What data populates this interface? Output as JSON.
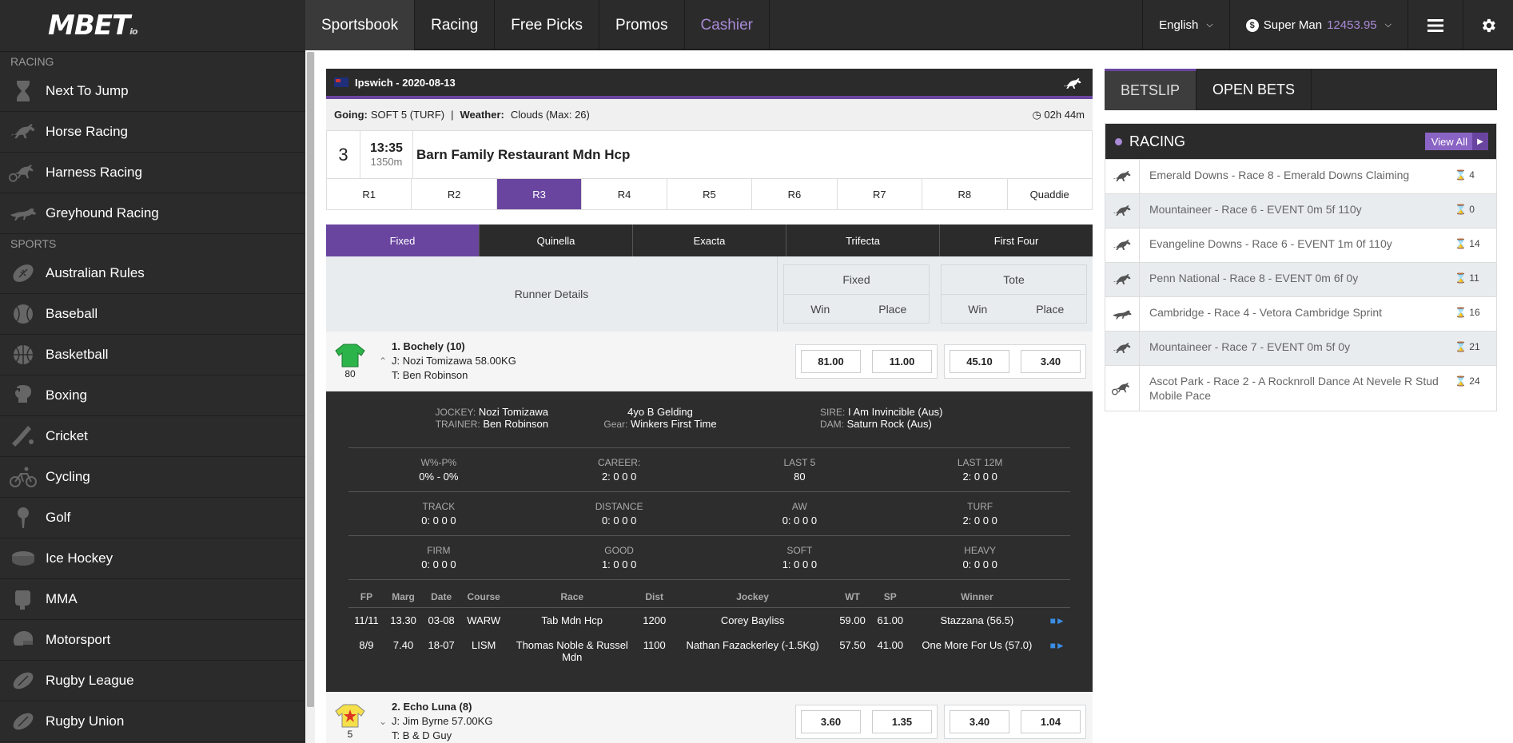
{
  "brand": {
    "logo_text": "MBET",
    "logo_suffix": "io"
  },
  "nav": {
    "items": [
      {
        "label": "Sportsbook"
      },
      {
        "label": "Racing"
      },
      {
        "label": "Free Picks"
      },
      {
        "label": "Promos"
      },
      {
        "label": "Cashier"
      }
    ],
    "language": "English",
    "user_name": "Super Man",
    "balance": "12453.95"
  },
  "sidebar": {
    "racing_header": "RACING",
    "racing": [
      {
        "label": "Next To Jump",
        "icon": "hourglass-icon"
      },
      {
        "label": "Horse Racing",
        "icon": "horse-icon"
      },
      {
        "label": "Harness Racing",
        "icon": "harness-icon"
      },
      {
        "label": "Greyhound Racing",
        "icon": "greyhound-icon"
      }
    ],
    "sports_header": "SPORTS",
    "sports": [
      {
        "label": "Australian Rules",
        "icon": "football-icon"
      },
      {
        "label": "Baseball",
        "icon": "baseball-icon"
      },
      {
        "label": "Basketball",
        "icon": "basketball-icon"
      },
      {
        "label": "Boxing",
        "icon": "boxing-icon"
      },
      {
        "label": "Cricket",
        "icon": "cricket-icon"
      },
      {
        "label": "Cycling",
        "icon": "cycling-icon"
      },
      {
        "label": "Golf",
        "icon": "golf-icon"
      },
      {
        "label": "Ice Hockey",
        "icon": "hockey-icon"
      },
      {
        "label": "MMA",
        "icon": "mma-icon"
      },
      {
        "label": "Motorsport",
        "icon": "motorsport-icon"
      },
      {
        "label": "Rugby League",
        "icon": "rugby-icon"
      },
      {
        "label": "Rugby Union",
        "icon": "rugby-union-icon"
      }
    ]
  },
  "race": {
    "venue_date": "Ipswich - 2020-08-13",
    "going_label": "Going:",
    "going_value": "SOFT 5 (TURF)",
    "weather_label": "Weather:",
    "weather_value": "Clouds (Max: 26)",
    "countdown": "02h 44m",
    "number": "3",
    "time": "13:35",
    "distance": "1350m",
    "name": "Barn Family Restaurant Mdn Hcp",
    "tabs": [
      "R1",
      "R2",
      "R3",
      "R4",
      "R5",
      "R6",
      "R7",
      "R8",
      "Quaddie"
    ],
    "active_tab": "R3"
  },
  "bet_types": [
    "Fixed",
    "Quinella",
    "Exacta",
    "Trifecta",
    "First Four"
  ],
  "runner_head": {
    "details": "Runner Details",
    "fixed": "Fixed",
    "tote": "Tote",
    "win": "Win",
    "place": "Place"
  },
  "runners": [
    {
      "title": "1. Bochely (10)",
      "jockey": "J: Nozi Tomizawa 58.00KG",
      "trainer": "T: Ben Robinson",
      "rating": "80",
      "fixed_win": "81.00",
      "fixed_place": "11.00",
      "tote_win": "45.10",
      "tote_place": "3.40",
      "caret": "^"
    },
    {
      "title": "2. Echo Luna (8)",
      "jockey": "J: Jim Byrne 57.00KG",
      "trainer": "T: B & D Guy",
      "rating": "5",
      "fixed_win": "3.60",
      "fixed_place": "1.35",
      "tote_win": "3.40",
      "tote_place": "1.04",
      "caret": "v"
    }
  ],
  "detail": {
    "jockey_label": "JOCKEY:",
    "jockey": "Nozi Tomizawa",
    "trainer_label": "TRAINER:",
    "trainer": "Ben Robinson",
    "age_sex": "4yo B Gelding",
    "gear_label": "Gear:",
    "gear": "Winkers First Time",
    "sire_label": "SIRE:",
    "sire": "I Am Invincible (Aus)",
    "dam_label": "DAM:",
    "dam": "Saturn Rock (Aus)",
    "stats": [
      [
        {
          "l": "W%-P%",
          "v": "0% - 0%"
        },
        {
          "l": "CAREER:",
          "v": "2: 0 0 0"
        },
        {
          "l": "LAST 5",
          "v": "80"
        },
        {
          "l": "LAST 12M",
          "v": "2: 0 0 0"
        }
      ],
      [
        {
          "l": "TRACK",
          "v": "0: 0 0 0"
        },
        {
          "l": "DISTANCE",
          "v": "0: 0 0 0"
        },
        {
          "l": "AW",
          "v": "0: 0 0 0"
        },
        {
          "l": "TURF",
          "v": "2: 0 0 0"
        }
      ],
      [
        {
          "l": "FIRM",
          "v": "0: 0 0 0"
        },
        {
          "l": "GOOD",
          "v": "1: 0 0 0"
        },
        {
          "l": "SOFT",
          "v": "1: 0 0 0"
        },
        {
          "l": "HEAVY",
          "v": "0: 0 0 0"
        }
      ]
    ],
    "form_headers": [
      "FP",
      "Marg",
      "Date",
      "Course",
      "Race",
      "Dist",
      "Jockey",
      "WT",
      "SP",
      "Winner",
      ""
    ],
    "form_rows": [
      [
        "11/11",
        "13.30",
        "03-08",
        "WARW",
        "Tab Mdn Hcp",
        "1200",
        "Corey Bayliss",
        "59.00",
        "61.00",
        "Stazzana (56.5)"
      ],
      [
        "8/9",
        "7.40",
        "18-07",
        "LISM",
        "Thomas Noble & Russel Mdn",
        "1100",
        "Nathan Fazackerley (-1.5Kg)",
        "57.50",
        "41.00",
        "One More For Us (57.0)"
      ]
    ]
  },
  "betslip": {
    "tabs": [
      "BETSLIP",
      "OPEN BETS"
    ],
    "racing_title": "RACING",
    "view_all": "View All",
    "items": [
      {
        "name": "Emerald Downs - Race 8 - Emerald Downs Claiming",
        "time": "4",
        "icon": "horse-icon"
      },
      {
        "name": "Mountaineer - Race 6 - EVENT 0m 5f 110y",
        "time": "0",
        "icon": "horse-icon"
      },
      {
        "name": "Evangeline Downs - Race 6 - EVENT 1m 0f 110y",
        "time": "14",
        "icon": "horse-icon"
      },
      {
        "name": "Penn National - Race 8 - EVENT 0m 6f 0y",
        "time": "11",
        "icon": "horse-icon"
      },
      {
        "name": "Cambridge - Race 4 - Vetora Cambridge Sprint",
        "time": "16",
        "icon": "greyhound-icon"
      },
      {
        "name": "Mountaineer - Race 7 - EVENT 0m 5f 0y",
        "time": "21",
        "icon": "horse-icon"
      },
      {
        "name": "Ascot Park - Race 2 - A Rocknroll Dance At Nevele R Stud Mobile Pace",
        "time": "24",
        "icon": "harness-icon"
      }
    ]
  },
  "colors": {
    "accent": "#6a45a0",
    "accent_light": "#a98bd6",
    "dark": "#2b2b2b"
  }
}
